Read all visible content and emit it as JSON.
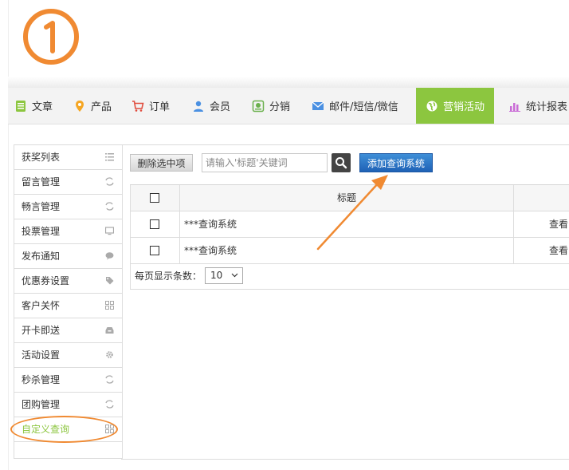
{
  "step_marker": "①",
  "nav": {
    "items": [
      {
        "label": "文章",
        "icon": "article-icon"
      },
      {
        "label": "产品",
        "icon": "location-pin-icon"
      },
      {
        "label": "订单",
        "icon": "cart-icon"
      },
      {
        "label": "会员",
        "icon": "user-icon"
      },
      {
        "label": "分销",
        "icon": "share-icon"
      },
      {
        "label": "邮件/短信/微信",
        "icon": "mail-icon"
      },
      {
        "label": "营销活动",
        "icon": "globe-icon",
        "active": true
      },
      {
        "label": "统计报表",
        "icon": "bar-chart-icon"
      }
    ]
  },
  "sidebar": {
    "items": [
      {
        "label": "获奖列表"
      },
      {
        "label": "留言管理"
      },
      {
        "label": "畅言管理"
      },
      {
        "label": "投票管理"
      },
      {
        "label": "发布通知"
      },
      {
        "label": "优惠券设置"
      },
      {
        "label": "客户关怀"
      },
      {
        "label": "开卡即送"
      },
      {
        "label": "活动设置"
      },
      {
        "label": "秒杀管理"
      },
      {
        "label": "团购管理"
      },
      {
        "label": "自定义查询",
        "active": true
      }
    ]
  },
  "toolbar": {
    "delete_label": "删除选中项",
    "search_placeholder": "请输入'标题'关键词",
    "add_label": "添加查询系统"
  },
  "table": {
    "columns": [
      "标题"
    ],
    "rows": [
      {
        "title": "***查询系统",
        "action": "查看"
      },
      {
        "title": "***查询系统",
        "action": "查看"
      }
    ]
  },
  "pager": {
    "label": "每页显示条数：",
    "page_size": "10"
  },
  "colors": {
    "accent": "#8cc63f",
    "annotation": "#f08a32",
    "primary_button": "#1f62b6"
  }
}
